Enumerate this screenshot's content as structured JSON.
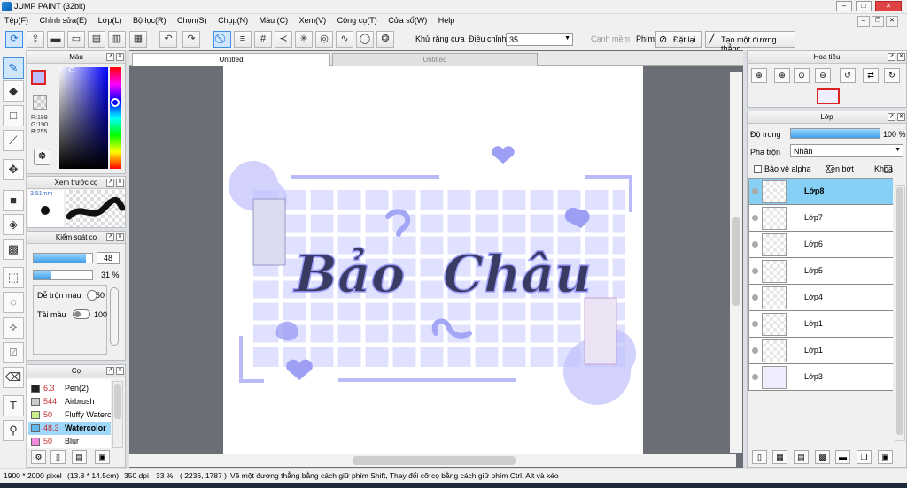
{
  "window": {
    "title": "JUMP PAINT (32bit)",
    "controls": [
      "–",
      "□",
      "✕"
    ]
  },
  "menu": [
    "Tệp(F)",
    "Chỉnh sửa(E)",
    "Lớp(L)",
    "Bộ lọc(R)",
    "Chọn(S)",
    "Chụp(N)",
    "Màu (C)",
    "Xem(V)",
    "Công cụ(T)",
    "Cửa sổ(W)",
    "Help"
  ],
  "toolbar": {
    "antialias_label": "Khử răng cưa",
    "adjust_label": "Điều chỉnh",
    "adjust_value": "35",
    "edge_label": "Cạnh mềm",
    "key_label": "Phím",
    "reset_label": "Đặt lại",
    "line_label": "Tạo một đường thẳng"
  },
  "color_panel": {
    "title": "Màu",
    "r": "R:189",
    "g": "G:190",
    "b": "B:255",
    "fg_color": "#bdbeff"
  },
  "brush_preview": {
    "title": "Xem trước cọ",
    "size": "3.51mm"
  },
  "brush_control": {
    "title": "Kiểm soát cọ",
    "size_value": "48",
    "size_fill": 0.9,
    "opacity_value": "31 %",
    "opacity_fill": 0.31,
    "blend_label": "Dễ trộn màu",
    "blend_value": "50",
    "ink_label": "Tải màu",
    "ink_value": "100"
  },
  "brush_list": {
    "title": "Cọ",
    "items": [
      {
        "size": "6.3",
        "name": "Pen(2)",
        "color": "#222222",
        "selected": false
      },
      {
        "size": "544",
        "name": "Airbrush",
        "color": "#cccccc",
        "selected": false
      },
      {
        "size": "50",
        "name": "Fluffy Watercolor",
        "color": "#c8f08a",
        "selected": false
      },
      {
        "size": "48.3",
        "name": "Watercolor",
        "color": "#5fb8f0",
        "selected": true
      },
      {
        "size": "50",
        "name": "Blur",
        "color": "#f08ad8",
        "selected": false
      }
    ]
  },
  "doc_tabs": [
    {
      "label": "Untitled",
      "active": true
    },
    {
      "label": "Untitled",
      "active": false
    }
  ],
  "artwork": {
    "line1": "Bảo",
    "line2": "Châu"
  },
  "navigator": {
    "title": "Hoa tiêu"
  },
  "layers": {
    "title": "Lớp",
    "opacity_label": "Độ trong",
    "opacity_value": "100 %",
    "blend_label": "Pha trộn",
    "blend_value": "Nhân",
    "protect_alpha": "Bảo vệ alpha",
    "clipping": "Xén bớt",
    "lock": "Khóa",
    "items": [
      {
        "name": "Lớp8",
        "selected": true
      },
      {
        "name": "Lớp7",
        "selected": false
      },
      {
        "name": "Lớp6",
        "selected": false
      },
      {
        "name": "Lớp5",
        "selected": false
      },
      {
        "name": "Lớp4",
        "selected": false
      },
      {
        "name": "Lớp1",
        "selected": false
      },
      {
        "name": "Lớp1",
        "selected": false
      },
      {
        "name": "Lớp3",
        "selected": false
      }
    ]
  },
  "status": {
    "dims": "1900 * 2000 pixel",
    "size_cm": "(13.8 * 14.5cm)",
    "dpi": "350 dpi",
    "zoom": "33 %",
    "coords": "( 2236, 1787 )",
    "hint": "Vẽ một đường thẳng bằng cách giữ phím Shift, Thay đổi cỡ cọ bằng cách giữ phím Ctrl, Alt và kéo"
  }
}
